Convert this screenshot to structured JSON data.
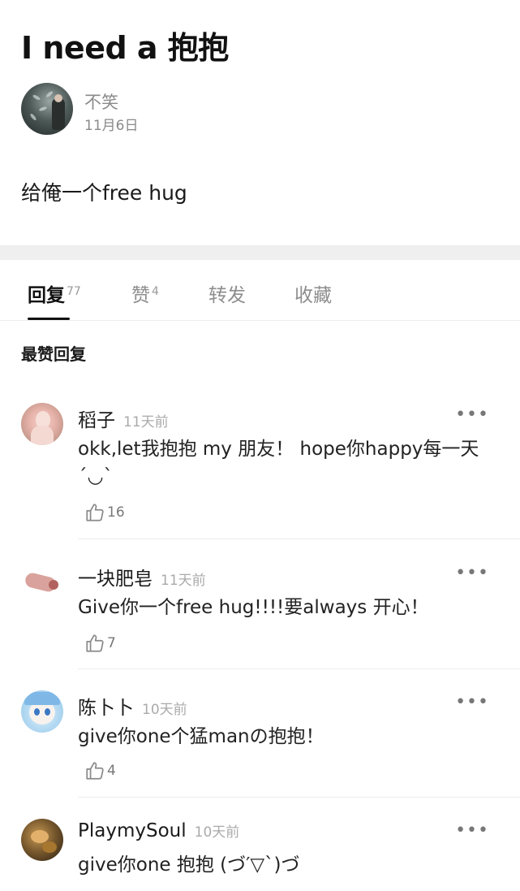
{
  "post": {
    "title": "I need a 抱抱",
    "author": "不笑",
    "date": "11月6日",
    "body": "给俺一个free hug"
  },
  "tabs": [
    {
      "label": "回复",
      "count": "77",
      "active": true
    },
    {
      "label": "赞",
      "count": "4",
      "active": false
    },
    {
      "label": "转发",
      "count": "",
      "active": false
    },
    {
      "label": "收藏",
      "count": "",
      "active": false
    }
  ],
  "section_heading": "最赞回复",
  "more_glyph": "•••",
  "comments": [
    {
      "name": "稻子",
      "time": "11天前",
      "text": "okk,let我抱抱 my 朋友！ hope你happy每一天´◡`",
      "likes": "16",
      "avatar_icon": "portrait-avatar-icon"
    },
    {
      "name": "一块肥皂",
      "time": "11天前",
      "text": "Give你一个free hug!!!!要always 开心！",
      "likes": "7",
      "avatar_icon": "soap-avatar-icon"
    },
    {
      "name": "陈卜卜",
      "time": "10天前",
      "text": "give你one个猛manの抱抱！",
      "likes": "4",
      "avatar_icon": "anime-girl-avatar-icon"
    },
    {
      "name": "PlaymySoul",
      "time": "10天前",
      "text": "give你one 抱抱 (づ′▽`)づ",
      "likes": "",
      "avatar_icon": "food-avatar-icon"
    }
  ]
}
